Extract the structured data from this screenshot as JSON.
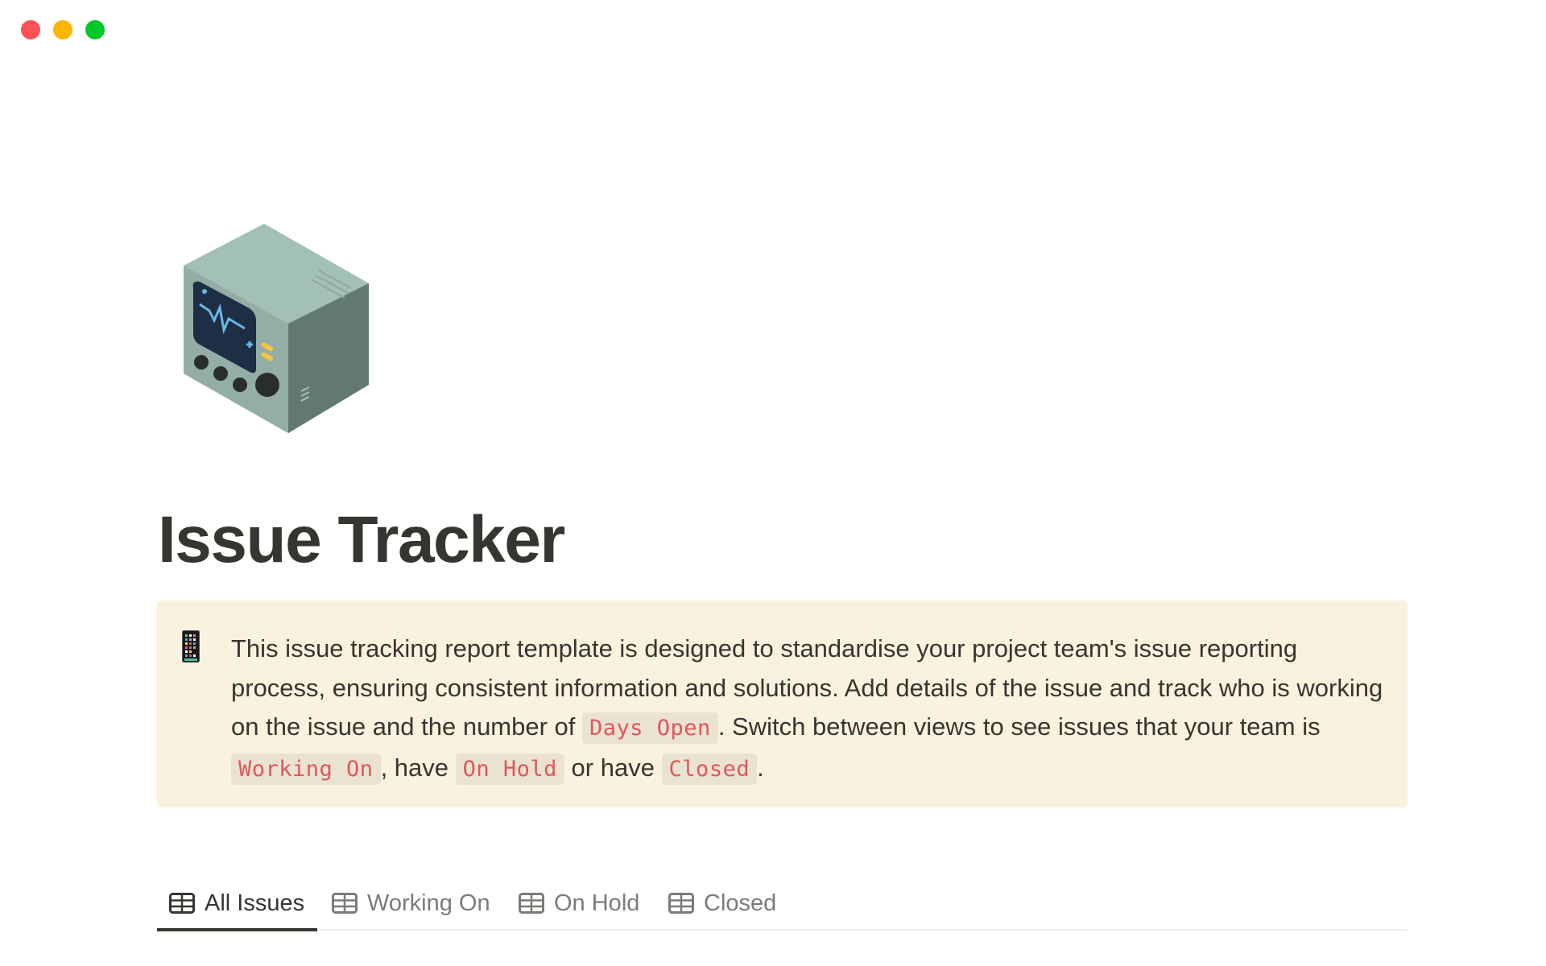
{
  "window": {
    "controls": [
      {
        "name": "close",
        "color": "#ff5257"
      },
      {
        "name": "minimize",
        "color": "#ffb600"
      },
      {
        "name": "zoom",
        "color": "#00c827"
      }
    ]
  },
  "page": {
    "icon": "medical-monitor-icon",
    "title": "Issue Tracker"
  },
  "callout": {
    "icon": "mobile-phone-icon",
    "segments": [
      {
        "type": "text",
        "value": "This issue tracking report template is designed to standardise your project team's issue reporting process, ensuring consistent information and solutions. Add details of the issue and track who is working on the issue and the number of "
      },
      {
        "type": "code",
        "value": "Days Open"
      },
      {
        "type": "text",
        "value": ". Switch between views to see issues that your team is "
      },
      {
        "type": "code",
        "value": "Working On"
      },
      {
        "type": "text",
        "value": ", have "
      },
      {
        "type": "code",
        "value": "On Hold"
      },
      {
        "type": "text",
        "value": " or have "
      },
      {
        "type": "code",
        "value": "Closed"
      },
      {
        "type": "text",
        "value": "."
      }
    ],
    "background": "#f9f2df",
    "code_color": "#e0575a"
  },
  "views": {
    "tabs": [
      {
        "label": "All Issues",
        "icon": "table-icon",
        "active": true
      },
      {
        "label": "Working On",
        "icon": "table-icon",
        "active": false
      },
      {
        "label": "On Hold",
        "icon": "table-icon",
        "active": false
      },
      {
        "label": "Closed",
        "icon": "table-icon",
        "active": false
      }
    ]
  }
}
